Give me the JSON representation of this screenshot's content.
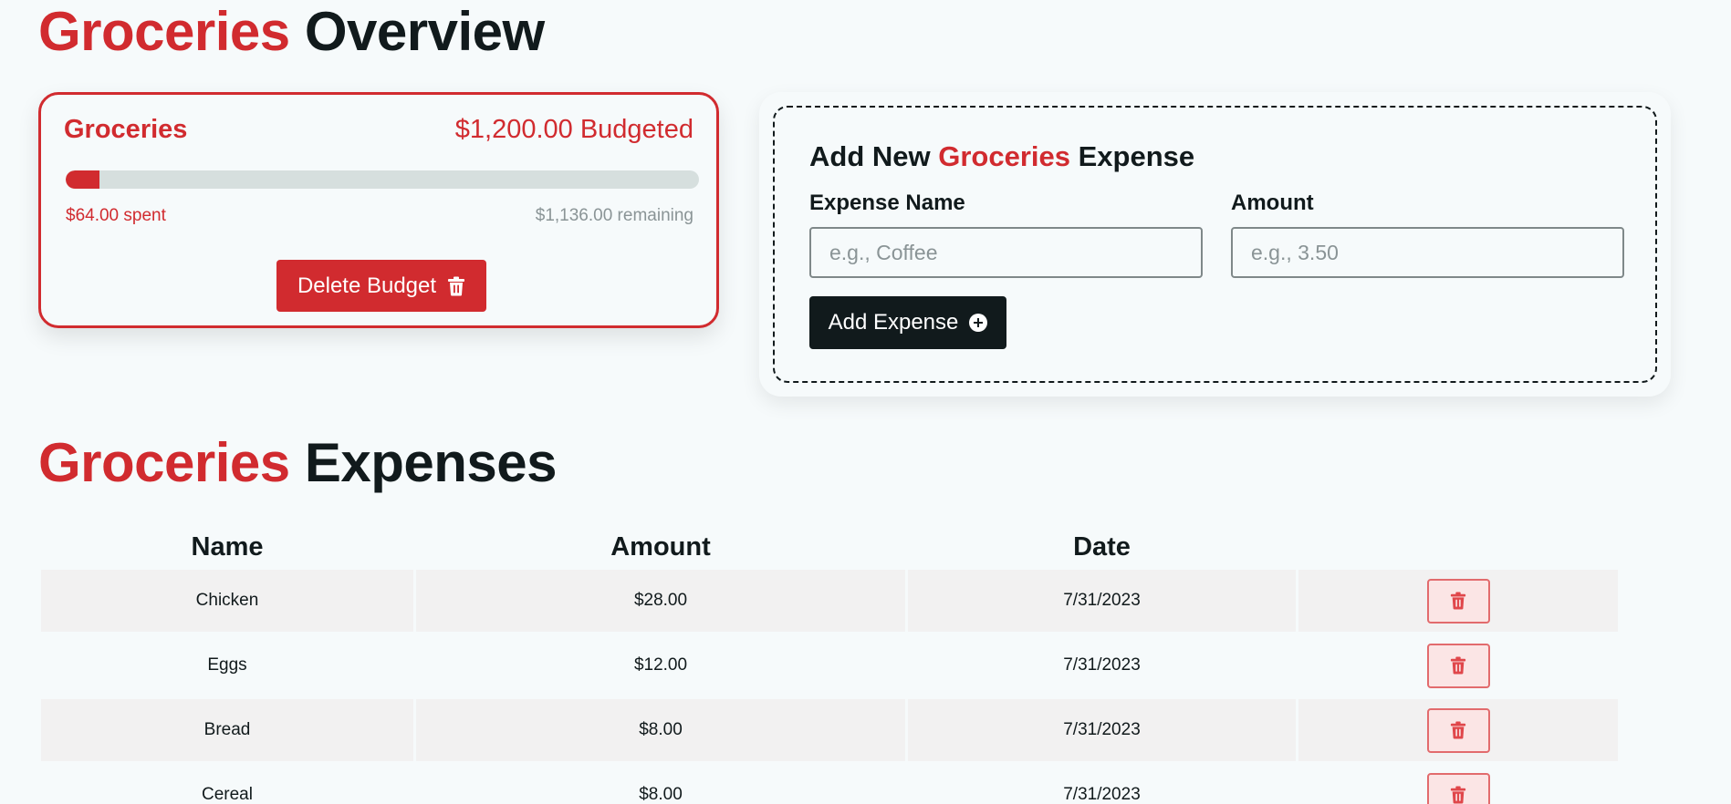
{
  "overview": {
    "title_accent": "Groceries",
    "title_rest": " Overview"
  },
  "budget": {
    "name": "Groceries",
    "amount_text": "$1,200.00 Budgeted",
    "spent_text": "$64.00 spent",
    "remaining_text": "$1,136.00 remaining",
    "progress_fraction": 0.0533,
    "delete_label": "Delete Budget",
    "delete_icon": "trash-icon"
  },
  "add_expense": {
    "title_prefix": "Add New ",
    "title_accent": "Groceries",
    "title_suffix": " Expense",
    "name_label": "Expense Name",
    "name_placeholder": "e.g., Coffee",
    "amount_label": "Amount",
    "amount_placeholder": "e.g., 3.50",
    "submit_label": "Add Expense",
    "submit_icon": "plus-circle-icon"
  },
  "expenses": {
    "title_accent": "Groceries",
    "title_rest": " Expenses",
    "headers": {
      "name": "Name",
      "amount": "Amount",
      "date": "Date"
    },
    "rows": [
      {
        "name": "Chicken",
        "amount": "$28.00",
        "date": "7/31/2023"
      },
      {
        "name": "Eggs",
        "amount": "$12.00",
        "date": "7/31/2023"
      },
      {
        "name": "Bread",
        "amount": "$8.00",
        "date": "7/31/2023"
      },
      {
        "name": "Cereal",
        "amount": "$8.00",
        "date": "7/31/2023"
      }
    ]
  },
  "colors": {
    "accent": "#d12b2f",
    "dark": "#111a1c",
    "background": "#f6fafb"
  }
}
